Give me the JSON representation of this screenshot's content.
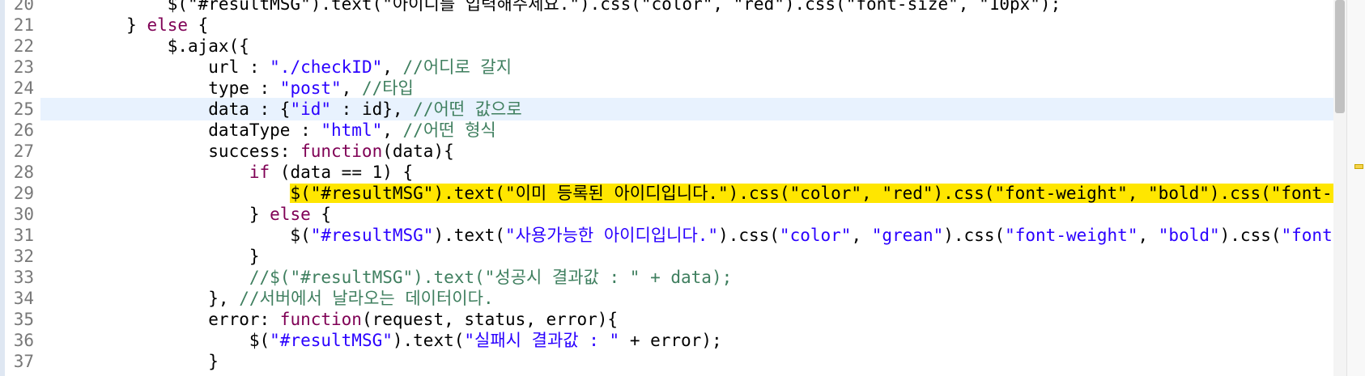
{
  "editor": {
    "lines": [
      {
        "num": "20",
        "parts": [
          {
            "t": "plain",
            "v": "            $(\"#resultMSG\").text(\"아이디를 입력해주세요.\").css(\"color\", \"red\").css(\"font-size\", \"10px\");"
          }
        ]
      },
      {
        "num": "21",
        "parts": [
          {
            "t": "plain",
            "v": "        } "
          },
          {
            "t": "kw",
            "v": "else"
          },
          {
            "t": "plain",
            "v": " {"
          }
        ]
      },
      {
        "num": "22",
        "parts": [
          {
            "t": "plain",
            "v": "            $.ajax({"
          }
        ]
      },
      {
        "num": "23",
        "parts": [
          {
            "t": "plain",
            "v": "                url : "
          },
          {
            "t": "str",
            "v": "\"./checkID\""
          },
          {
            "t": "plain",
            "v": ", "
          },
          {
            "t": "cmt",
            "v": "//어디로 갈지"
          }
        ]
      },
      {
        "num": "24",
        "parts": [
          {
            "t": "plain",
            "v": "                type : "
          },
          {
            "t": "str",
            "v": "\"post\""
          },
          {
            "t": "plain",
            "v": ", "
          },
          {
            "t": "cmt",
            "v": "//타입"
          }
        ]
      },
      {
        "num": "25",
        "parts": [
          {
            "t": "plain",
            "v": "                data : {"
          },
          {
            "t": "str",
            "v": "\"id\""
          },
          {
            "t": "plain",
            "v": " : id}, "
          },
          {
            "t": "cmt",
            "v": "//어떤 값으로"
          }
        ]
      },
      {
        "num": "26",
        "parts": [
          {
            "t": "plain",
            "v": "                dataType : "
          },
          {
            "t": "str",
            "v": "\"html\""
          },
          {
            "t": "plain",
            "v": ", "
          },
          {
            "t": "cmt",
            "v": "//어떤 형식"
          }
        ]
      },
      {
        "num": "27",
        "parts": [
          {
            "t": "plain",
            "v": "                success: "
          },
          {
            "t": "kw",
            "v": "function"
          },
          {
            "t": "plain",
            "v": "(data){"
          }
        ]
      },
      {
        "num": "28",
        "parts": [
          {
            "t": "plain",
            "v": "                    "
          },
          {
            "t": "kw",
            "v": "if"
          },
          {
            "t": "plain",
            "v": " (data == 1) {"
          }
        ]
      },
      {
        "num": "29",
        "parts": [
          {
            "t": "plain",
            "v": "                        $(\"#resultMSG\").text(\"이미 등록된 아이디입니다.\").css(\"color\", \"red\").css(\"font-weight\", \"bold\").css(\"font-si"
          }
        ]
      },
      {
        "num": "30",
        "parts": [
          {
            "t": "plain",
            "v": "                    } "
          },
          {
            "t": "kw",
            "v": "else"
          },
          {
            "t": "plain",
            "v": " {"
          }
        ]
      },
      {
        "num": "31",
        "parts": [
          {
            "t": "plain",
            "v": "                        $("
          },
          {
            "t": "str",
            "v": "\"#resultMSG\""
          },
          {
            "t": "plain",
            "v": ").text("
          },
          {
            "t": "str",
            "v": "\"사용가능한 아이디입니다.\""
          },
          {
            "t": "plain",
            "v": ").css("
          },
          {
            "t": "str",
            "v": "\"color\""
          },
          {
            "t": "plain",
            "v": ", "
          },
          {
            "t": "str",
            "v": "\"grean\""
          },
          {
            "t": "plain",
            "v": ").css("
          },
          {
            "t": "str",
            "v": "\"font-weight\""
          },
          {
            "t": "plain",
            "v": ", "
          },
          {
            "t": "str",
            "v": "\"bold\""
          },
          {
            "t": "plain",
            "v": ").css("
          },
          {
            "t": "str",
            "v": "\"font-s"
          }
        ]
      },
      {
        "num": "32",
        "parts": [
          {
            "t": "plain",
            "v": "                    }"
          }
        ]
      },
      {
        "num": "33",
        "parts": [
          {
            "t": "plain",
            "v": "                    "
          },
          {
            "t": "cmt",
            "v": "//$(\"#resultMSG\").text(\"성공시 결과값 : \" + data);"
          }
        ]
      },
      {
        "num": "34",
        "parts": [
          {
            "t": "plain",
            "v": "                }, "
          },
          {
            "t": "cmt",
            "v": "//서버에서 날라오는 데이터이다."
          }
        ]
      },
      {
        "num": "35",
        "parts": [
          {
            "t": "plain",
            "v": "                error: "
          },
          {
            "t": "kw",
            "v": "function"
          },
          {
            "t": "plain",
            "v": "(request, status, error){"
          }
        ]
      },
      {
        "num": "36",
        "parts": [
          {
            "t": "plain",
            "v": "                    $("
          },
          {
            "t": "str",
            "v": "\"#resultMSG\""
          },
          {
            "t": "plain",
            "v": ").text("
          },
          {
            "t": "str",
            "v": "\"실패시 결과값 : \""
          },
          {
            "t": "plain",
            "v": " + error);"
          }
        ]
      },
      {
        "num": "37",
        "parts": [
          {
            "t": "plain",
            "v": "                }"
          }
        ]
      }
    ],
    "current_line_index": 5,
    "highlighted_line_index": 9
  },
  "colors": {
    "keyword": "#7f0055",
    "string": "#2a00ff",
    "comment": "#3f7f5f",
    "current_line": "#e8f2fe",
    "search_highlight": "#ffe600"
  }
}
